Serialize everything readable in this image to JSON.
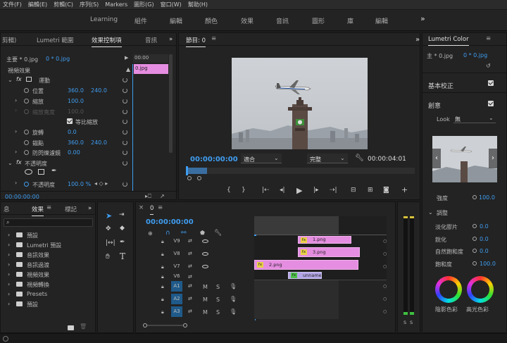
{
  "menu": [
    "文件(F)",
    "編輯(E)",
    "剪輯(C)",
    "序列(S)",
    "Markers",
    "圖形(G)",
    "窗口(W)",
    "幫助(H)"
  ],
  "workspaces": [
    "Learning",
    "組件",
    "編輯",
    "顏色",
    "效果",
    "音訊",
    "圖形",
    "庫",
    "編輯"
  ],
  "effect_controls": {
    "tabs": [
      "剪輯)",
      "Lumetri 範圍",
      "效果控制項",
      "音訊"
    ],
    "master_label": "主要 * 0.jpg",
    "sequence_label": "0 * 0.jpg",
    "ruler_time": "00:00",
    "clip_name": "0.jpg",
    "video_effects_header": "視頻效果",
    "motion": "運動",
    "position": {
      "label": "位置",
      "x": "360.0",
      "y": "240.0"
    },
    "scale": {
      "label": "縮放",
      "value": "100.0"
    },
    "scale_width": {
      "label": "縮放寬度",
      "value": "100.0"
    },
    "uniform_scale": "等比縮放",
    "rotation": {
      "label": "旋轉",
      "value": "0.0"
    },
    "anchor": {
      "label": "錨點",
      "x": "360.0",
      "y": "240.0"
    },
    "anti_flicker": {
      "label": "防閃爍濾鏡",
      "value": "0.00"
    },
    "opacity_group": "不透明度",
    "opacity": {
      "label": "不透明度",
      "value": "100.0 %"
    },
    "timecode": "00:00:00:00"
  },
  "program_monitor": {
    "tab": "節目: 0",
    "timecode": "00:00:00:00",
    "fit": "適合",
    "quality": "完整",
    "duration": "00:00:04:01"
  },
  "project": {
    "tabs": [
      "息",
      "效果",
      "標記"
    ],
    "items": [
      "預設",
      "Lumetri 預設",
      "音訊效果",
      "音訊過渡",
      "視頻效果",
      "視頻轉換",
      "Presets",
      "預設"
    ]
  },
  "timeline": {
    "tab": "0",
    "timecode": "00:00:00:00",
    "video_tracks": [
      "V9",
      "V8",
      "V7",
      "V6"
    ],
    "audio_tracks": [
      "A1",
      "A2",
      "A3"
    ],
    "clips": [
      {
        "name": "1.png"
      },
      {
        "name": "3.png"
      },
      {
        "name": "2.png"
      },
      {
        "name": "unnamed.j"
      }
    ]
  },
  "audio_meter": {
    "left": "S",
    "right": "S"
  },
  "lumetri": {
    "title": "Lumetri Color",
    "master": "主 * 0.jpg",
    "sequence": "0 * 0.jpg",
    "basic": "基本校正",
    "creative": "創意",
    "look_label": "Look",
    "look_value": "無",
    "intensity_label": "強度",
    "intensity_value": "100.0",
    "adjust": "調整",
    "faded_film": {
      "label": "淡化膠片",
      "value": "0.0"
    },
    "sharpen": {
      "label": "銳化",
      "value": "0.0"
    },
    "vibrance": {
      "label": "自然飽和度",
      "value": "0.0"
    },
    "saturation": {
      "label": "飽和度",
      "value": "100.0"
    },
    "shadow_tint": "陰影色彩",
    "highlight_tint": "高光色彩"
  },
  "colors": {
    "accent": "#3f9df0",
    "clip_pink": "#e58de0",
    "audio_track": "#1f5a8a",
    "panel": "#232323"
  }
}
